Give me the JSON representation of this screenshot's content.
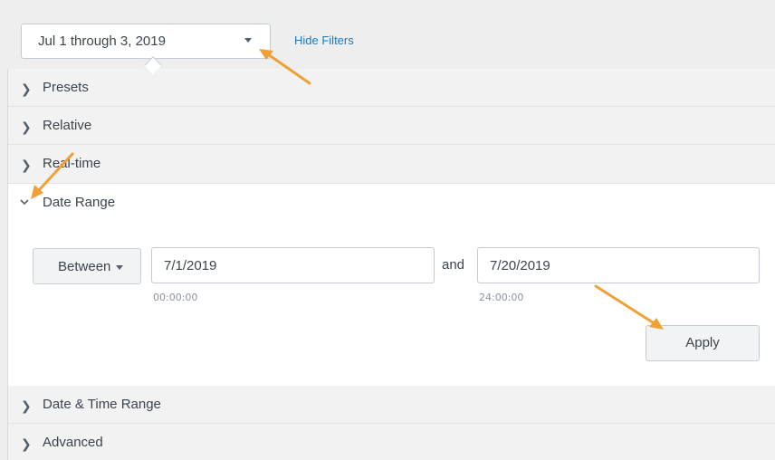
{
  "filter_bar": {
    "time_range_label": "Jul 1 through 3, 2019",
    "hide_filters_label": "Hide Filters"
  },
  "accordion": {
    "presets": "Presets",
    "relative": "Relative",
    "real_time": "Real-time",
    "date_range": "Date Range",
    "date_time_range": "Date & Time Range",
    "advanced": "Advanced"
  },
  "date_range": {
    "mode_label": "Between",
    "earliest_value": "7/1/2019",
    "earliest_time": "00:00:00",
    "and_label": "and",
    "latest_value": "7/20/2019",
    "latest_time": "24:00:00",
    "apply_label": "Apply"
  },
  "colors": {
    "accent_link": "#1a7bb9",
    "annotation_arrow": "#f0a035"
  }
}
